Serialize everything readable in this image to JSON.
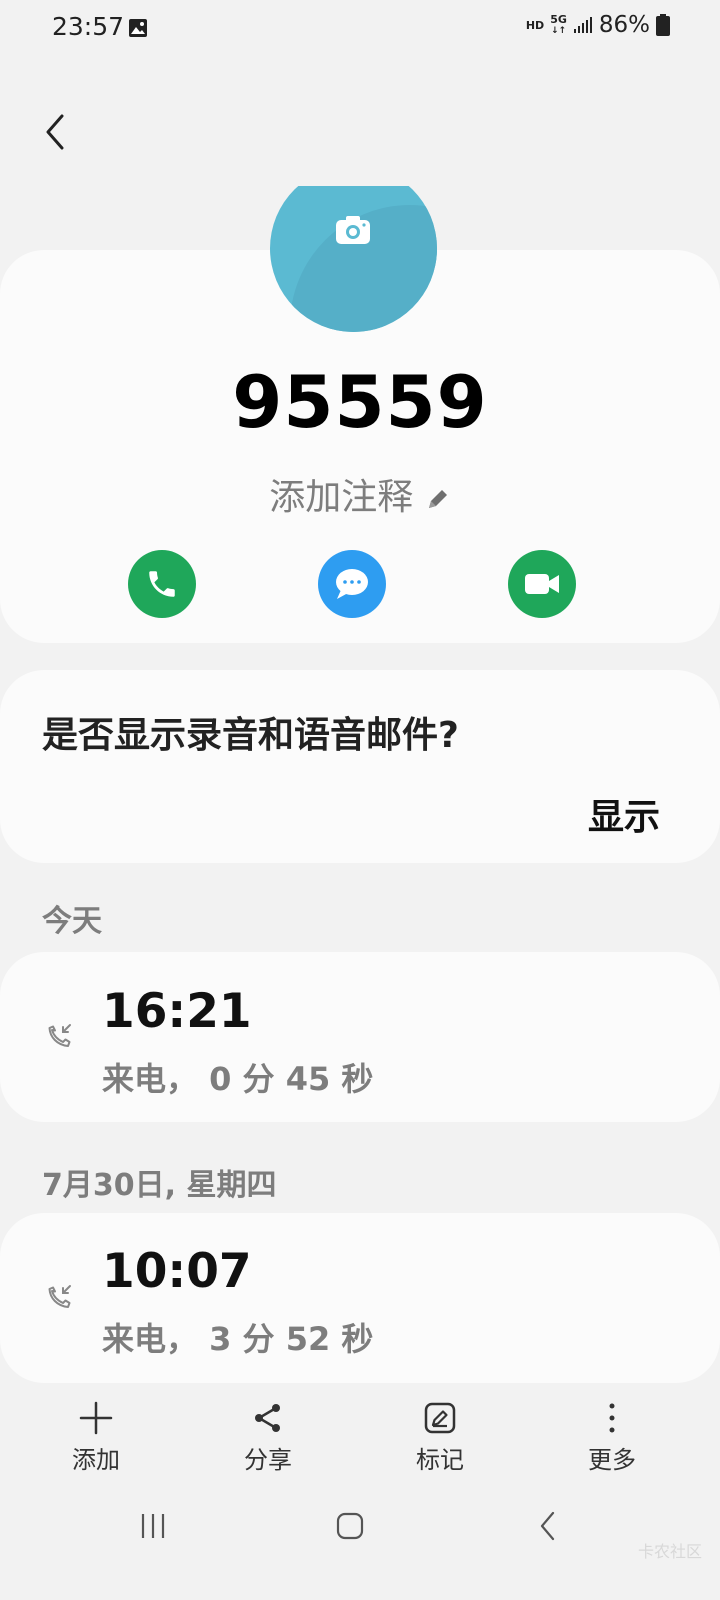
{
  "status_bar": {
    "time": "23:57",
    "hd": "HD",
    "network": "5G",
    "battery": "86%"
  },
  "contact": {
    "number": "95559",
    "add_note": "添加注释",
    "avatar_color": "#5bbad2"
  },
  "actions": {
    "call_color": "#1fa75a",
    "message_color": "#2e9df1",
    "video_color": "#1fa75a"
  },
  "voicemail": {
    "question": "是否显示录音和语音邮件?",
    "show_label": "显示"
  },
  "call_log": [
    {
      "section": "今天",
      "time": "16:21",
      "detail": "来电， 0 分 45 秒"
    },
    {
      "section": "7月30日, 星期四",
      "time": "10:07",
      "detail": "来电， 3 分 52 秒"
    }
  ],
  "bottom_bar": {
    "add_label": "添加",
    "share_label": "分享",
    "mark_label": "标记",
    "more_label": "更多"
  },
  "watermark": "卡农社区"
}
